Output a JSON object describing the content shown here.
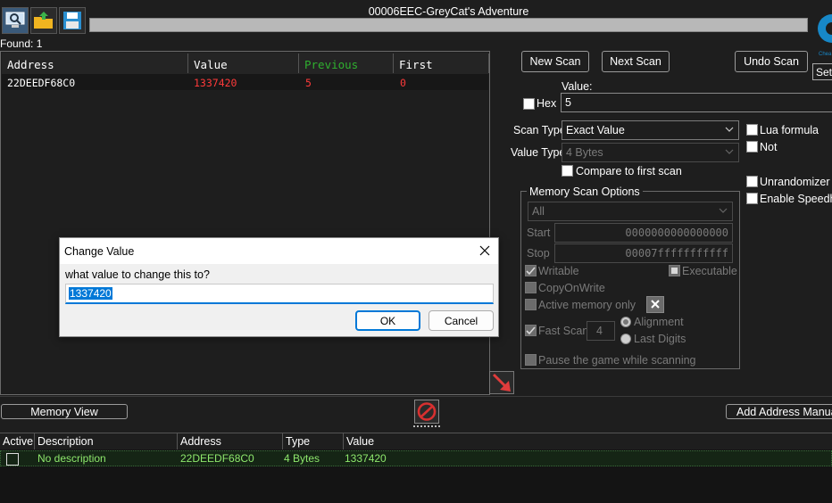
{
  "window": {
    "title": "00006EEC-GreyCat's Adventure",
    "found_label": "Found: 1"
  },
  "toolbar": {
    "open_process_icon": "computer-icon",
    "open_file_icon": "folder-icon",
    "save_icon": "floppy-icon",
    "settings_label": "Sett",
    "logo_text": "Chea"
  },
  "results": {
    "columns": [
      "Address",
      "Value",
      "Previous",
      "First"
    ],
    "rows": [
      {
        "address": "22DEEDF68C0",
        "value": "1337420",
        "previous": "5",
        "first": "0"
      }
    ]
  },
  "scan": {
    "new_scan": "New Scan",
    "next_scan": "Next Scan",
    "undo_scan": "Undo Scan",
    "value_label": "Value:",
    "hex_label": "Hex",
    "value": "5",
    "scan_type_label": "Scan Type",
    "scan_type": "Exact Value",
    "value_type_label": "Value Type",
    "value_type": "4 Bytes",
    "compare_first": "Compare to first scan",
    "lua_formula": "Lua formula",
    "not": "Not",
    "unrandomizer": "Unrandomizer",
    "speedhack": "Enable Speedha"
  },
  "memory_options": {
    "title": "Memory Scan Options",
    "region": "All",
    "start_label": "Start",
    "start": "0000000000000000",
    "stop_label": "Stop",
    "stop": "00007fffffffffff",
    "writable": "Writable",
    "executable": "Executable",
    "copy_on_write": "CopyOnWrite",
    "active_memory": "Active memory only",
    "fast_scan": "Fast Scan",
    "fast_scan_value": "4",
    "alignment": "Alignment",
    "last_digits": "Last Digits",
    "pause": "Pause the game while scanning"
  },
  "bottom": {
    "memory_view": "Memory View",
    "add_address": "Add Address Manua"
  },
  "address_list": {
    "columns": [
      "Active",
      "Description",
      "Address",
      "Type",
      "Value"
    ],
    "rows": [
      {
        "description": "No description",
        "address": "22DEEDF68C0",
        "type": "4 Bytes",
        "value": "1337420"
      }
    ]
  },
  "dialog": {
    "title": "Change Value",
    "prompt": "what value to change this to?",
    "input": "1337420",
    "ok": "OK",
    "cancel": "Cancel"
  },
  "colors": {
    "value_red": "#ff3a3a",
    "previous_green": "#2fb02f",
    "list_green": "#8ee86c",
    "selection_blue": "#0078d7"
  }
}
